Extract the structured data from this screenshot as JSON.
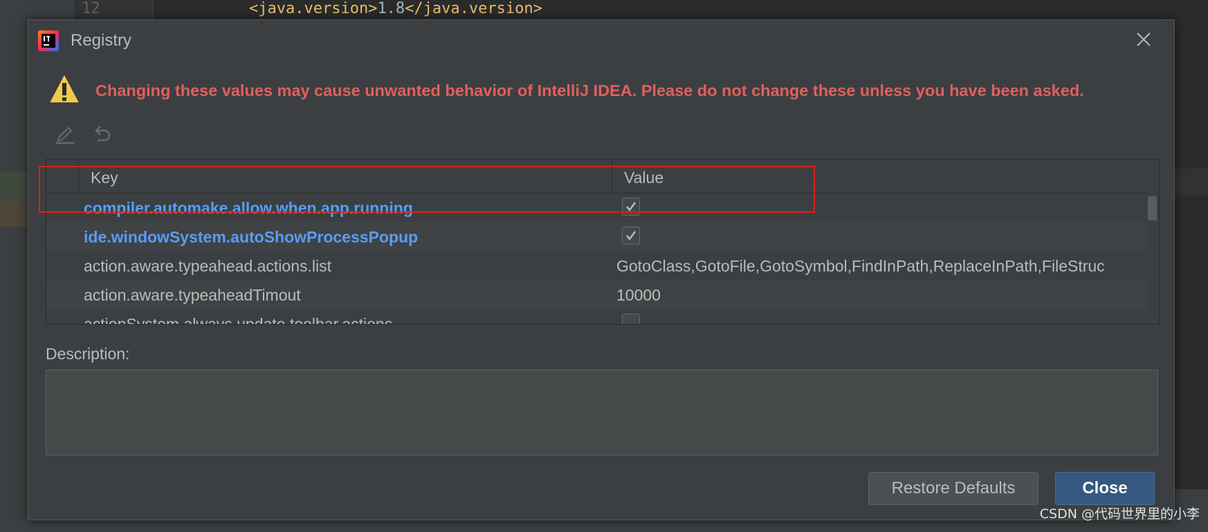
{
  "editor": {
    "line_number": "12",
    "code_open_tag": "<java.version>",
    "code_value": "1.8",
    "code_close_tag": "</java.version>"
  },
  "dialog": {
    "title": "Registry",
    "warning": "Changing these values may cause unwanted behavior of IntelliJ IDEA. Please do not change these unless you have been asked.",
    "toolbar": {
      "edit_icon": "pencil-icon",
      "revert_icon": "undo-icon"
    },
    "table": {
      "columns": [
        "Key",
        "Value"
      ],
      "rows": [
        {
          "key": "compiler.automake.allow.when.app.running",
          "value": "",
          "checked": true,
          "modified": true
        },
        {
          "key": "ide.windowSystem.autoShowProcessPopup",
          "value": "",
          "checked": true,
          "modified": true
        },
        {
          "key": "action.aware.typeahead.actions.list",
          "value": "GotoClass,GotoFile,GotoSymbol,FindInPath,ReplaceInPath,FileStruc",
          "modified": false
        },
        {
          "key": "action.aware.typeaheadTimout",
          "value": "10000",
          "modified": false
        },
        {
          "key": "actionSystem.always.update.toolbar.actions",
          "value": "",
          "checked": false,
          "modified": false
        }
      ]
    },
    "description_label": "Description:",
    "description_value": "",
    "buttons": {
      "restore": "Restore Defaults",
      "close": "Close"
    }
  },
  "watermark": "CSDN @代码世界里的小李",
  "colors": {
    "modified_key": "#589df6",
    "warning": "#e0605d",
    "highlight_box": "#d9231e",
    "primary_button": "#365880"
  }
}
